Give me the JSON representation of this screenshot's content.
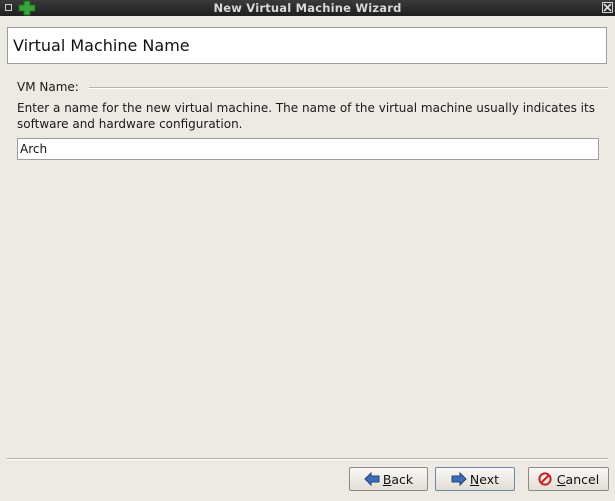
{
  "window": {
    "title": "New Virtual Machine Wizard"
  },
  "header": {
    "title": "Virtual Machine Name"
  },
  "section": {
    "label": "VM Name:",
    "description": "Enter a name for the new virtual machine. The name of the virtual machine usually indicates its software and hardware configuration."
  },
  "vm_name": {
    "value": "Arch"
  },
  "buttons": {
    "back": {
      "first": "B",
      "rest": "ack"
    },
    "next": {
      "first": "N",
      "rest": "ext"
    },
    "cancel": {
      "first": "C",
      "rest": "ancel"
    }
  },
  "colors": {
    "titlebar": "#2a2a2a",
    "background": "#edeae4",
    "app_icon": "#3aa53a",
    "cancel_icon": "#c82222",
    "arrow_icon": "#3d6bb5"
  },
  "icons": {
    "window_menu": "window-menu-icon",
    "app": "green-plus-icon",
    "close": "close-icon",
    "back": "back-arrow-icon",
    "next": "next-arrow-icon",
    "cancel": "cancel-icon"
  }
}
